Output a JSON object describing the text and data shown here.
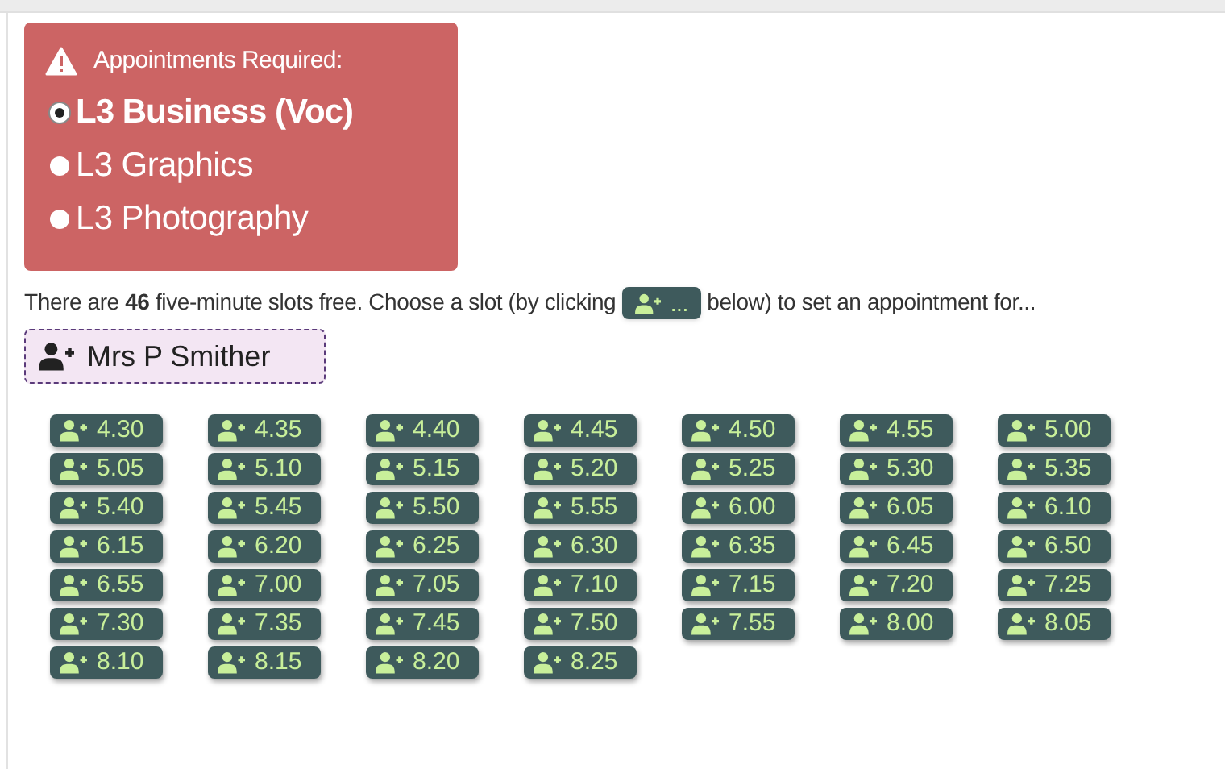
{
  "alert": {
    "title": "Appointments Required:",
    "options": [
      {
        "label": "L3 Business (Voc)",
        "selected": true
      },
      {
        "label": "L3 Graphics",
        "selected": false
      },
      {
        "label": "L3 Photography",
        "selected": false
      }
    ]
  },
  "instruction": {
    "before": "There are **46** five-minute slots free. Choose a slot (by clicking",
    "button": "...",
    "after": "below) to set an appointment for..."
  },
  "person": {
    "name": "Mrs P Smither"
  },
  "slots": [
    "4.30",
    "4.35",
    "4.40",
    "4.45",
    "4.50",
    "4.55",
    "5.00",
    "5.05",
    "5.10",
    "5.15",
    "5.20",
    "5.25",
    "5.30",
    "5.35",
    "5.40",
    "5.45",
    "5.50",
    "5.55",
    "6.00",
    "6.05",
    "6.10",
    "6.15",
    "6.20",
    "6.25",
    "6.30",
    "6.35",
    "6.45",
    "6.50",
    "6.55",
    "7.00",
    "7.05",
    "7.10",
    "7.15",
    "7.20",
    "7.25",
    "7.30",
    "7.35",
    "7.45",
    "7.50",
    "7.55",
    "8.00",
    "8.05",
    "8.10",
    "8.15",
    "8.20",
    "8.25"
  ]
}
